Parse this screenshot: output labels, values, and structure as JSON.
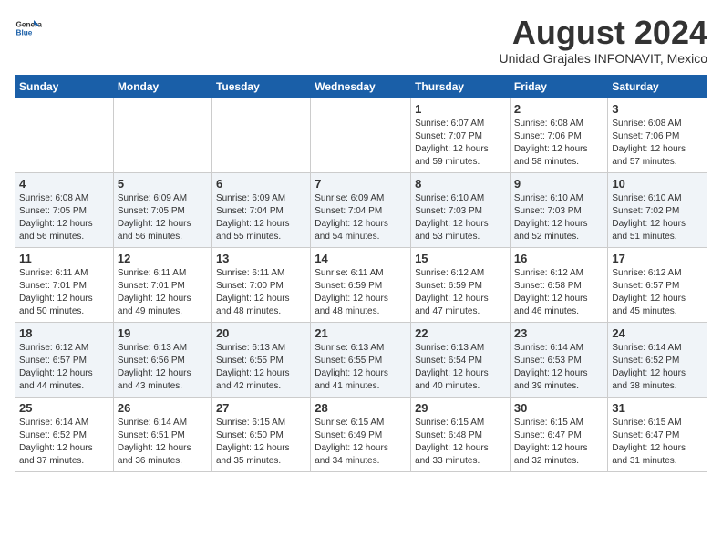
{
  "header": {
    "logo_line1": "General",
    "logo_line2": "Blue",
    "month_year": "August 2024",
    "location": "Unidad Grajales INFONAVIT, Mexico"
  },
  "weekdays": [
    "Sunday",
    "Monday",
    "Tuesday",
    "Wednesday",
    "Thursday",
    "Friday",
    "Saturday"
  ],
  "weeks": [
    [
      {
        "day": "",
        "info": ""
      },
      {
        "day": "",
        "info": ""
      },
      {
        "day": "",
        "info": ""
      },
      {
        "day": "",
        "info": ""
      },
      {
        "day": "1",
        "info": "Sunrise: 6:07 AM\nSunset: 7:07 PM\nDaylight: 12 hours\nand 59 minutes."
      },
      {
        "day": "2",
        "info": "Sunrise: 6:08 AM\nSunset: 7:06 PM\nDaylight: 12 hours\nand 58 minutes."
      },
      {
        "day": "3",
        "info": "Sunrise: 6:08 AM\nSunset: 7:06 PM\nDaylight: 12 hours\nand 57 minutes."
      }
    ],
    [
      {
        "day": "4",
        "info": "Sunrise: 6:08 AM\nSunset: 7:05 PM\nDaylight: 12 hours\nand 56 minutes."
      },
      {
        "day": "5",
        "info": "Sunrise: 6:09 AM\nSunset: 7:05 PM\nDaylight: 12 hours\nand 56 minutes."
      },
      {
        "day": "6",
        "info": "Sunrise: 6:09 AM\nSunset: 7:04 PM\nDaylight: 12 hours\nand 55 minutes."
      },
      {
        "day": "7",
        "info": "Sunrise: 6:09 AM\nSunset: 7:04 PM\nDaylight: 12 hours\nand 54 minutes."
      },
      {
        "day": "8",
        "info": "Sunrise: 6:10 AM\nSunset: 7:03 PM\nDaylight: 12 hours\nand 53 minutes."
      },
      {
        "day": "9",
        "info": "Sunrise: 6:10 AM\nSunset: 7:03 PM\nDaylight: 12 hours\nand 52 minutes."
      },
      {
        "day": "10",
        "info": "Sunrise: 6:10 AM\nSunset: 7:02 PM\nDaylight: 12 hours\nand 51 minutes."
      }
    ],
    [
      {
        "day": "11",
        "info": "Sunrise: 6:11 AM\nSunset: 7:01 PM\nDaylight: 12 hours\nand 50 minutes."
      },
      {
        "day": "12",
        "info": "Sunrise: 6:11 AM\nSunset: 7:01 PM\nDaylight: 12 hours\nand 49 minutes."
      },
      {
        "day": "13",
        "info": "Sunrise: 6:11 AM\nSunset: 7:00 PM\nDaylight: 12 hours\nand 48 minutes."
      },
      {
        "day": "14",
        "info": "Sunrise: 6:11 AM\nSunset: 6:59 PM\nDaylight: 12 hours\nand 48 minutes."
      },
      {
        "day": "15",
        "info": "Sunrise: 6:12 AM\nSunset: 6:59 PM\nDaylight: 12 hours\nand 47 minutes."
      },
      {
        "day": "16",
        "info": "Sunrise: 6:12 AM\nSunset: 6:58 PM\nDaylight: 12 hours\nand 46 minutes."
      },
      {
        "day": "17",
        "info": "Sunrise: 6:12 AM\nSunset: 6:57 PM\nDaylight: 12 hours\nand 45 minutes."
      }
    ],
    [
      {
        "day": "18",
        "info": "Sunrise: 6:12 AM\nSunset: 6:57 PM\nDaylight: 12 hours\nand 44 minutes."
      },
      {
        "day": "19",
        "info": "Sunrise: 6:13 AM\nSunset: 6:56 PM\nDaylight: 12 hours\nand 43 minutes."
      },
      {
        "day": "20",
        "info": "Sunrise: 6:13 AM\nSunset: 6:55 PM\nDaylight: 12 hours\nand 42 minutes."
      },
      {
        "day": "21",
        "info": "Sunrise: 6:13 AM\nSunset: 6:55 PM\nDaylight: 12 hours\nand 41 minutes."
      },
      {
        "day": "22",
        "info": "Sunrise: 6:13 AM\nSunset: 6:54 PM\nDaylight: 12 hours\nand 40 minutes."
      },
      {
        "day": "23",
        "info": "Sunrise: 6:14 AM\nSunset: 6:53 PM\nDaylight: 12 hours\nand 39 minutes."
      },
      {
        "day": "24",
        "info": "Sunrise: 6:14 AM\nSunset: 6:52 PM\nDaylight: 12 hours\nand 38 minutes."
      }
    ],
    [
      {
        "day": "25",
        "info": "Sunrise: 6:14 AM\nSunset: 6:52 PM\nDaylight: 12 hours\nand 37 minutes."
      },
      {
        "day": "26",
        "info": "Sunrise: 6:14 AM\nSunset: 6:51 PM\nDaylight: 12 hours\nand 36 minutes."
      },
      {
        "day": "27",
        "info": "Sunrise: 6:15 AM\nSunset: 6:50 PM\nDaylight: 12 hours\nand 35 minutes."
      },
      {
        "day": "28",
        "info": "Sunrise: 6:15 AM\nSunset: 6:49 PM\nDaylight: 12 hours\nand 34 minutes."
      },
      {
        "day": "29",
        "info": "Sunrise: 6:15 AM\nSunset: 6:48 PM\nDaylight: 12 hours\nand 33 minutes."
      },
      {
        "day": "30",
        "info": "Sunrise: 6:15 AM\nSunset: 6:47 PM\nDaylight: 12 hours\nand 32 minutes."
      },
      {
        "day": "31",
        "info": "Sunrise: 6:15 AM\nSunset: 6:47 PM\nDaylight: 12 hours\nand 31 minutes."
      }
    ]
  ]
}
